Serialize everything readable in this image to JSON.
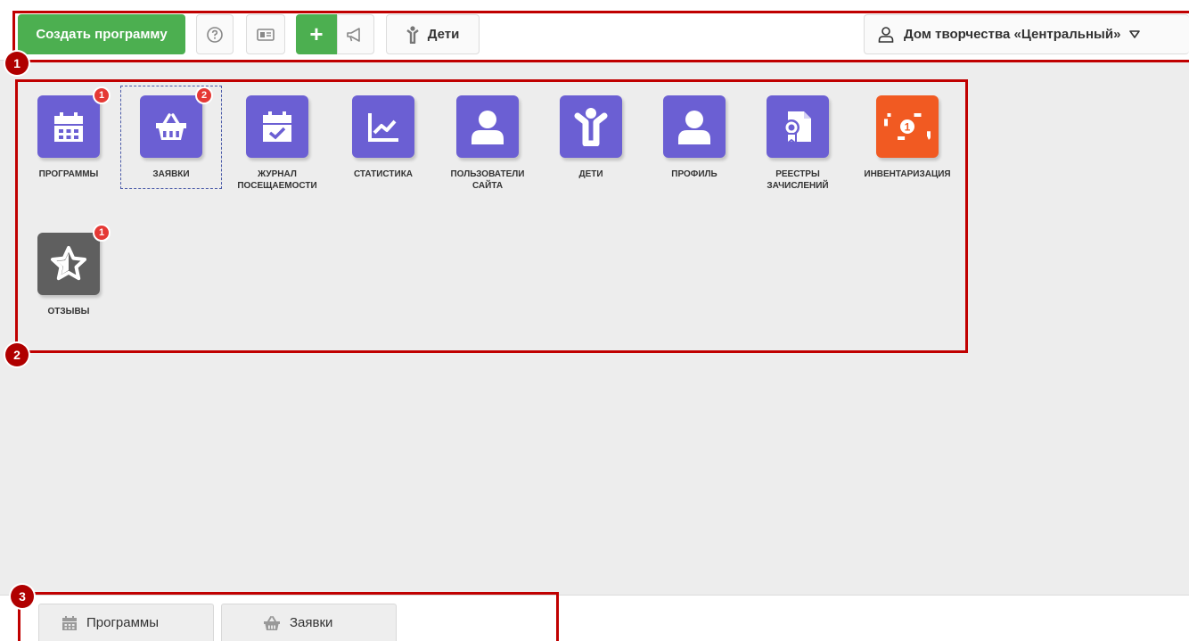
{
  "toolbar": {
    "create_label": "Создать программу",
    "add_label": "+",
    "kids_label": "Дети",
    "org_label": "Дом творчества «Центральный»"
  },
  "markers": [
    "1",
    "2",
    "3"
  ],
  "tiles": [
    {
      "label": "ПРОГРАММЫ",
      "badge": "1",
      "color": "#6b5fd3",
      "icon": "calendar-icon"
    },
    {
      "label": "ЗАЯВКИ",
      "badge": "2",
      "color": "#6b5fd3",
      "icon": "basket-icon"
    },
    {
      "label": "ЖУРНАЛ ПОСЕЩАЕМОСТИ",
      "color": "#6b5fd3",
      "icon": "calendar-check-icon"
    },
    {
      "label": "СТАТИСТИКА",
      "color": "#6b5fd3",
      "icon": "chart-icon"
    },
    {
      "label": "ПОЛЬЗОВАТЕЛИ САЙТА",
      "color": "#6b5fd3",
      "icon": "user-icon"
    },
    {
      "label": "ДЕТИ",
      "color": "#6b5fd3",
      "icon": "child-icon"
    },
    {
      "label": "ПРОФИЛЬ",
      "color": "#6b5fd3",
      "icon": "profile-icon"
    },
    {
      "label": "РЕЕСТРЫ ЗАЧИСЛЕНИЙ",
      "color": "#6b5fd3",
      "icon": "certificate-icon"
    },
    {
      "label": "ИНВЕНТАРИЗАЦИЯ",
      "color": "#f15a22",
      "icon": "money-icon",
      "inner": "1"
    },
    {
      "label": "ОТЗЫВЫ",
      "badge": "1",
      "color": "#5f5f5f",
      "icon": "star-icon"
    }
  ],
  "bottom_tabs": [
    {
      "label": "Программы",
      "icon": "calendar-icon"
    },
    {
      "label": "Заявки",
      "icon": "basket-icon"
    }
  ]
}
